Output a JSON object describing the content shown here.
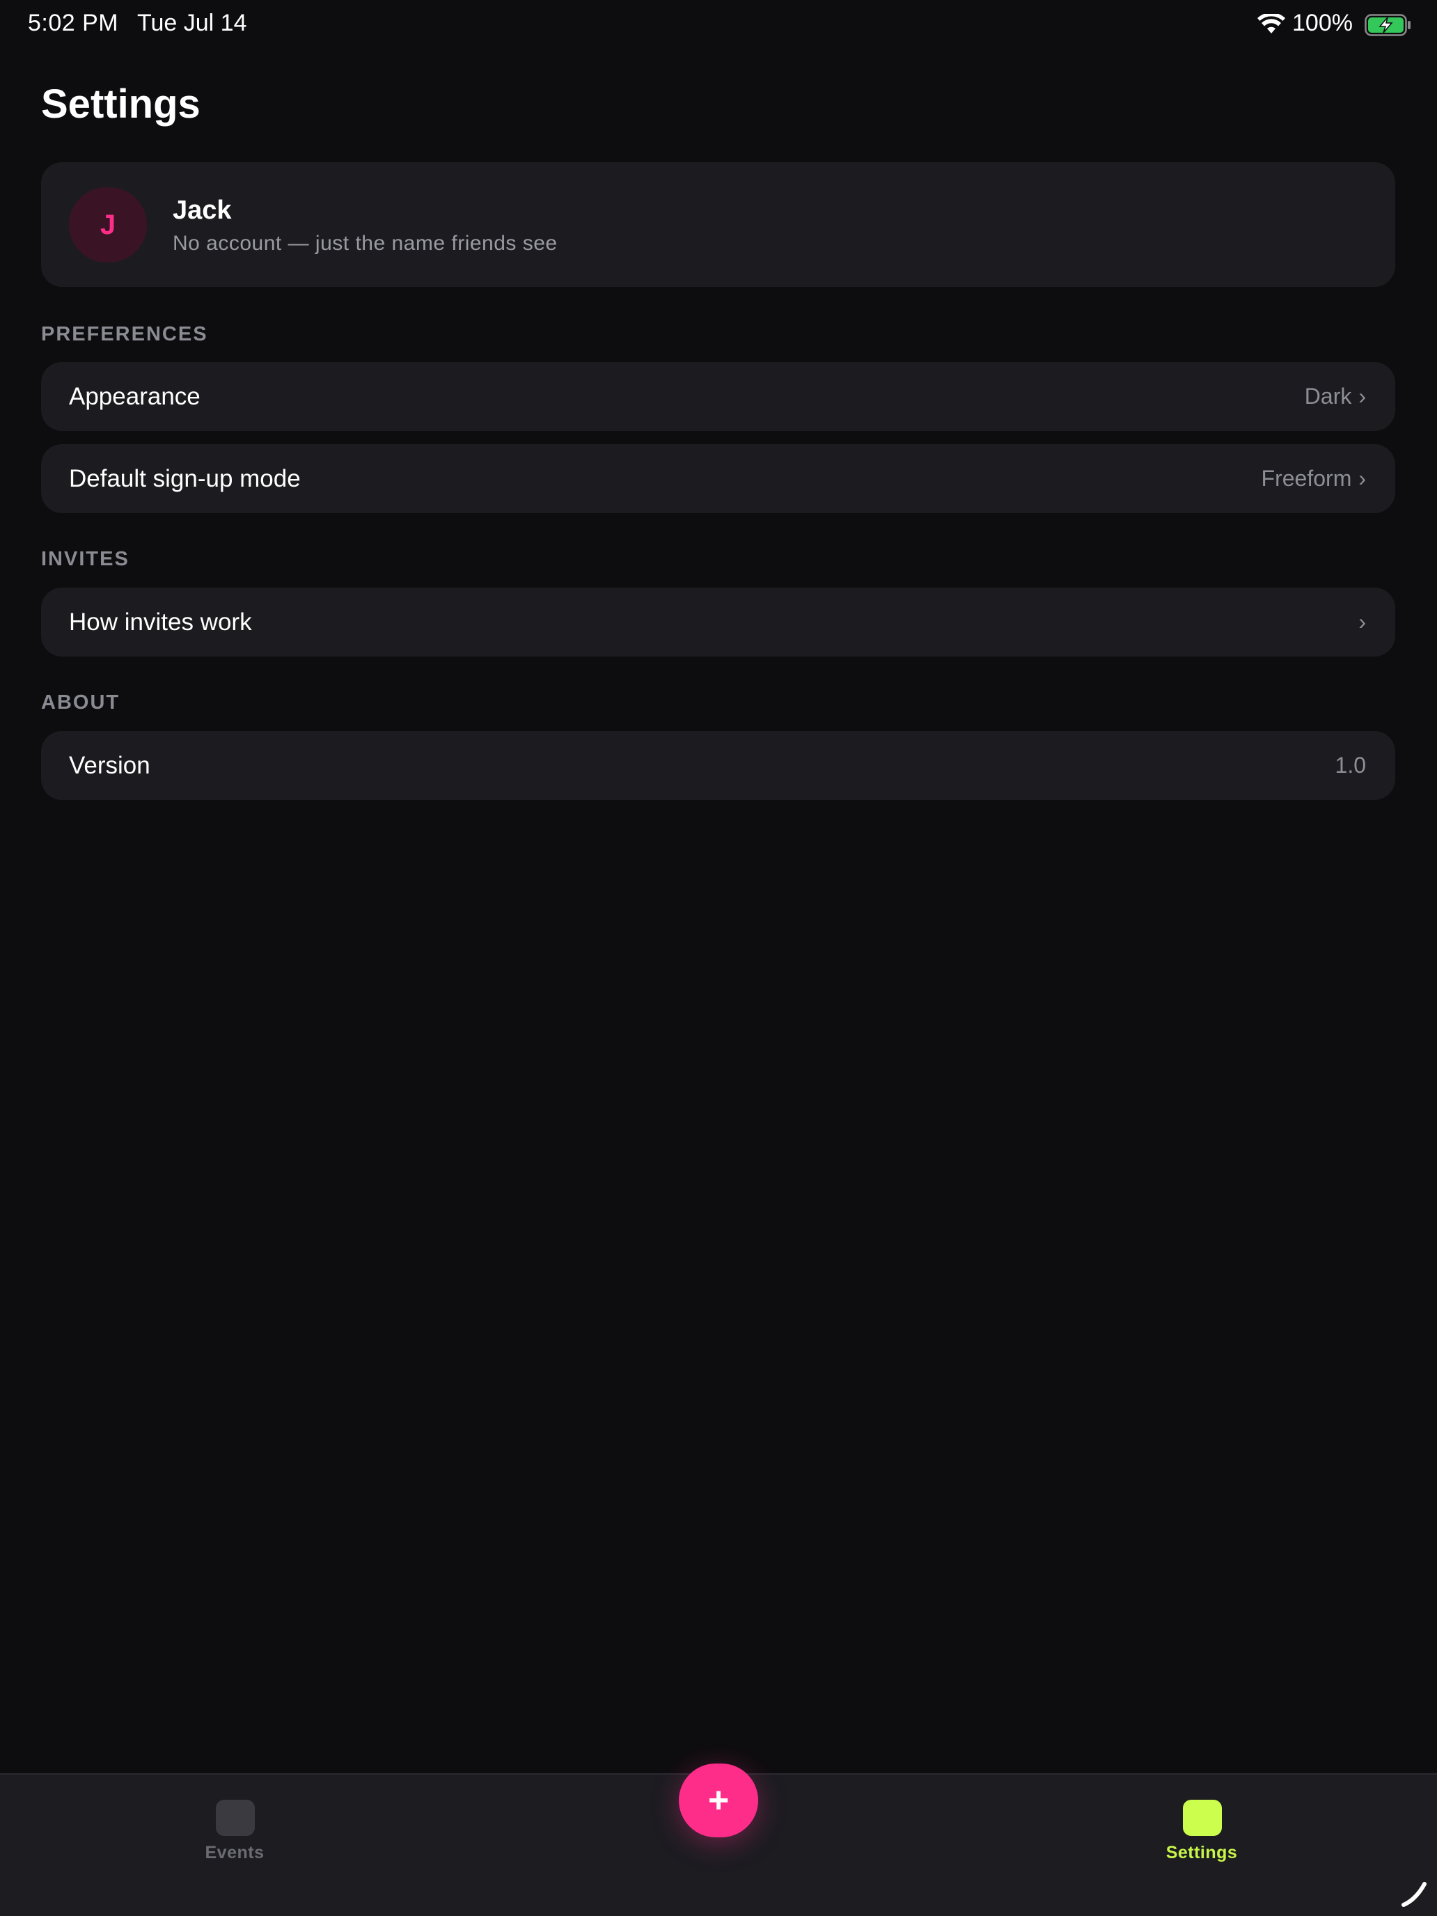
{
  "status_bar": {
    "time": "5:02 PM",
    "date": "Tue Jul 14",
    "battery_percent": "100%",
    "wifi_icon": "wifi-icon",
    "battery_icon": "battery-charging-icon"
  },
  "page": {
    "title": "Settings"
  },
  "profile": {
    "avatar_initial": "J",
    "name": "Jack",
    "subtitle": "No account — just the name friends see"
  },
  "sections": {
    "preferences": {
      "header": "PREFERENCES",
      "appearance": {
        "label": "Appearance",
        "value": "Dark"
      },
      "signup_mode": {
        "label": "Default sign-up mode",
        "value": "Freeform"
      }
    },
    "invites": {
      "header": "INVITES",
      "how_invites": {
        "label": "How invites work"
      }
    },
    "about": {
      "header": "ABOUT",
      "version": {
        "label": "Version",
        "value": "1.0"
      }
    }
  },
  "chevron": "›",
  "tab_bar": {
    "events_label": "Events",
    "settings_label": "Settings",
    "fab_label": "+"
  },
  "colors": {
    "background": "#0d0d0f",
    "card": "#1c1c20",
    "accent_pink": "#ff2d8a",
    "accent_lime": "#ccff4d",
    "muted_text": "#8e8e96"
  }
}
